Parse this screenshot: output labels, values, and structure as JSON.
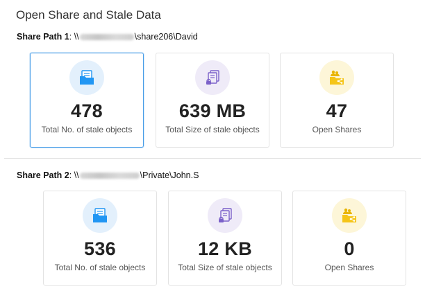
{
  "page": {
    "title": "Open Share and Stale Data"
  },
  "share_paths": [
    {
      "label": "Share Path 1",
      "separator": ":",
      "prefix": "\\\\",
      "suffix": "\\share206\\David",
      "cards": [
        {
          "value": "478",
          "caption": "Total No. of stale objects",
          "icon": "folder-document-icon",
          "color": "#2196f3"
        },
        {
          "value": "639 MB",
          "caption": "Total Size of stale objects",
          "icon": "locked-documents-icon",
          "color": "#7b61c9"
        },
        {
          "value": "47",
          "caption": "Open Shares",
          "icon": "shared-folder-icon",
          "color": "#f5c518"
        }
      ]
    },
    {
      "label": "Share Path 2",
      "separator": ":",
      "prefix": "\\\\",
      "suffix": "\\Private\\John.S",
      "cards": [
        {
          "value": "536",
          "caption": "Total No. of stale objects",
          "icon": "folder-document-icon",
          "color": "#2196f3"
        },
        {
          "value": "12 KB",
          "caption": "Total Size of stale objects",
          "icon": "locked-documents-icon",
          "color": "#7b61c9"
        },
        {
          "value": "0",
          "caption": "Open Shares",
          "icon": "shared-folder-icon",
          "color": "#f5c518"
        }
      ]
    }
  ]
}
